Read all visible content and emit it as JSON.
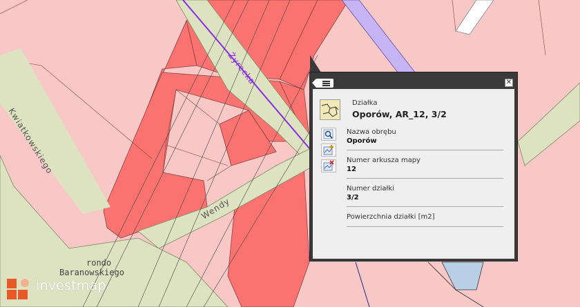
{
  "map": {
    "labels": {
      "road_1": "Kwiatkowskiego",
      "road_2": "Żyrecka",
      "road_3": "Wendy",
      "place_1": "rondo",
      "place_2": "Baranowskiego"
    },
    "colors": {
      "parcel_light": "#f8c8c6",
      "parcel_dark": "#fa7370",
      "road": "#dde2c0",
      "water": "#c6b4f5",
      "blue_area": "#b9cfe6",
      "white_block": "#ffffff"
    }
  },
  "popup": {
    "menu_icon": "list-icon",
    "close_icon": "close-icon",
    "header": {
      "type_label": "Działka",
      "title": "Oporów, AR_12, 3/2",
      "icon": "parcel-map-icon"
    },
    "tools": [
      "zoom-to-icon",
      "add-layer-icon",
      "remove-layer-icon"
    ],
    "attributes": [
      {
        "label": "Nazwa obrębu",
        "value": "Oporów"
      },
      {
        "label": "Numer arkusza mapy",
        "value": "12"
      },
      {
        "label": "Numer działki",
        "value": "3/2"
      },
      {
        "label": "Powierzchnia działki [m2]",
        "value": ""
      }
    ]
  },
  "logo": {
    "text": "investmap"
  }
}
